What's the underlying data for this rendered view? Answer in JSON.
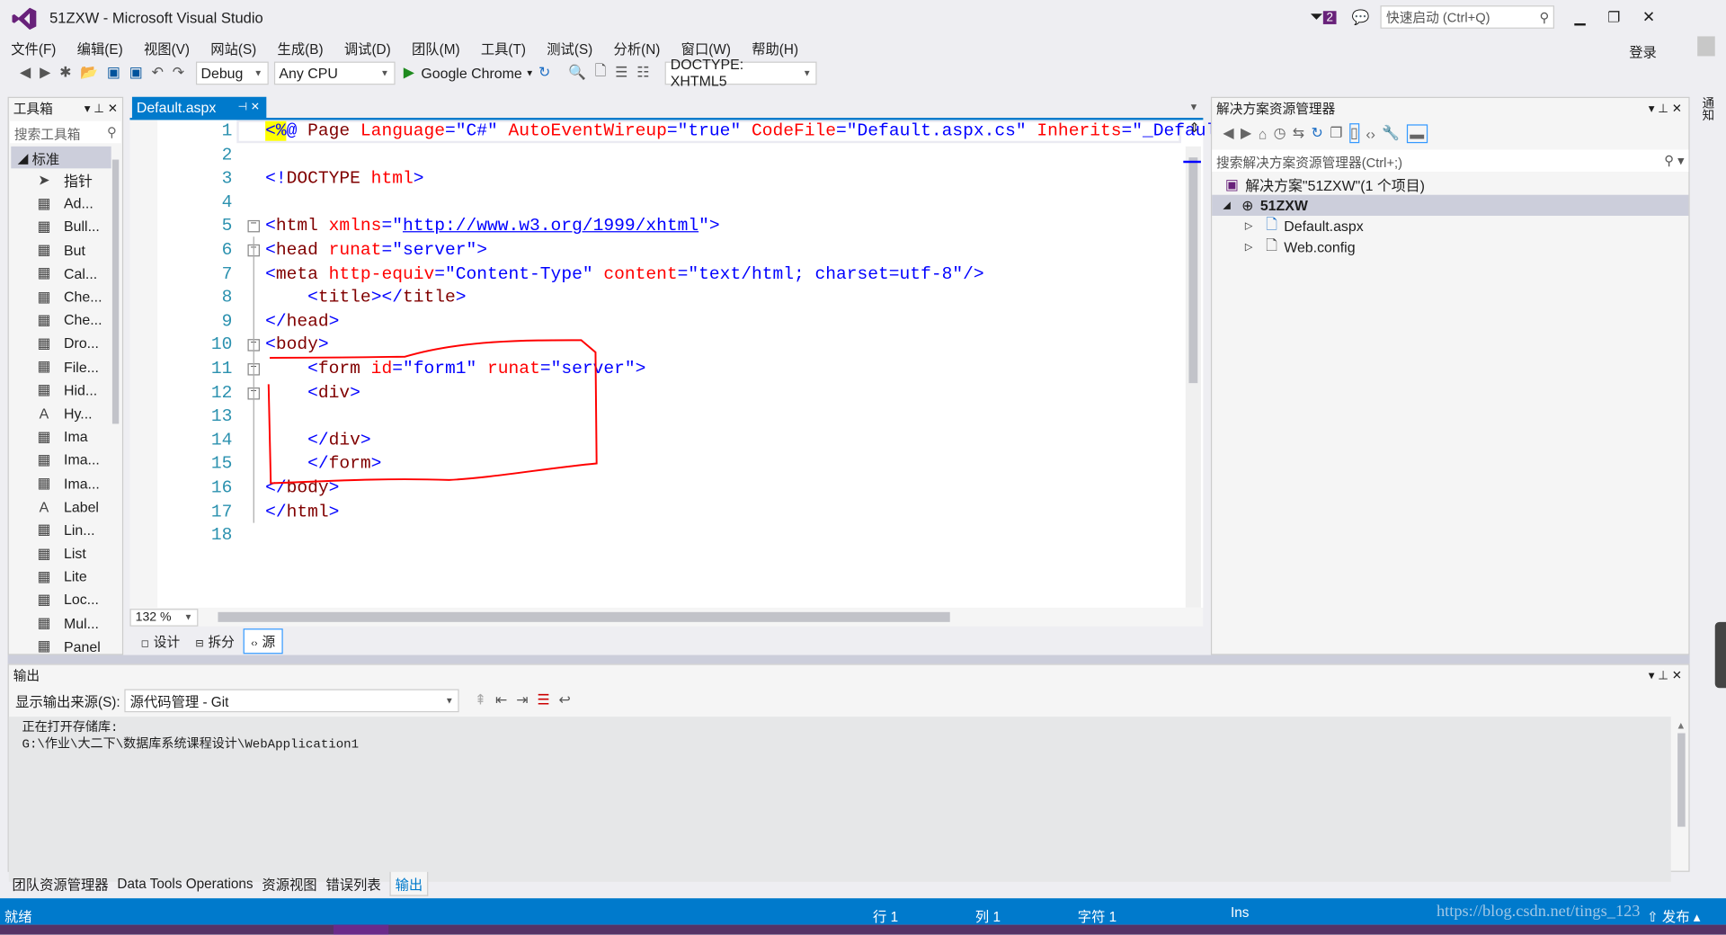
{
  "window": {
    "title": "51ZXW - Microsoft Visual Studio",
    "notification_count": "2",
    "quick_launch_placeholder": "快速启动 (Ctrl+Q)",
    "login": "登录",
    "notifications_tab": "通知"
  },
  "menu": [
    "文件(F)",
    "编辑(E)",
    "视图(V)",
    "网站(S)",
    "生成(B)",
    "调试(D)",
    "团队(M)",
    "工具(T)",
    "测试(S)",
    "分析(N)",
    "窗口(W)",
    "帮助(H)"
  ],
  "toolbar": {
    "config": "Debug",
    "platform": "Any CPU",
    "run_target": "Google Chrome",
    "doctype": "DOCTYPE: XHTML5"
  },
  "toolbox": {
    "title": "工具箱",
    "search_placeholder": "搜索工具箱",
    "group": "标准",
    "items": [
      {
        "icon": "pointer-icon",
        "label": "指针"
      },
      {
        "icon": "adrotator-icon",
        "label": "Ad..."
      },
      {
        "icon": "bulleted-list-icon",
        "label": "Bull..."
      },
      {
        "icon": "button-icon",
        "label": "But"
      },
      {
        "icon": "calendar-icon",
        "label": "Cal..."
      },
      {
        "icon": "checkbox-icon",
        "label": "Che..."
      },
      {
        "icon": "checkbox-list-icon",
        "label": "Che..."
      },
      {
        "icon": "dropdown-icon",
        "label": "Dro..."
      },
      {
        "icon": "fileupload-icon",
        "label": "File..."
      },
      {
        "icon": "hiddenfield-icon",
        "label": "Hid..."
      },
      {
        "icon": "hyperlink-icon",
        "label": "Hy..."
      },
      {
        "icon": "image-icon",
        "label": "Ima"
      },
      {
        "icon": "imagebutton-icon",
        "label": "Ima..."
      },
      {
        "icon": "imagemap-icon",
        "label": "Ima..."
      },
      {
        "icon": "label-icon",
        "label": "Label"
      },
      {
        "icon": "linkbutton-icon",
        "label": "Lin..."
      },
      {
        "icon": "list-icon",
        "label": "List"
      },
      {
        "icon": "literal-icon",
        "label": "Lite"
      },
      {
        "icon": "localize-icon",
        "label": "Loc..."
      },
      {
        "icon": "multiview-icon",
        "label": "Mul..."
      },
      {
        "icon": "panel-icon",
        "label": "Panel"
      }
    ]
  },
  "editor": {
    "tab": "Default.aspx",
    "zoom": "132 %",
    "views": [
      "设计",
      "拆分",
      "源"
    ],
    "active_view": "源",
    "lines": [
      [
        [
          "<%",
          "b dir"
        ],
        [
          "@",
          "v"
        ],
        [
          " Page ",
          "tg"
        ],
        [
          "Language",
          "at"
        ],
        [
          "=",
          "b"
        ],
        [
          "\"C#\"",
          "v"
        ],
        [
          " AutoEventWireup",
          "at"
        ],
        [
          "=",
          "b"
        ],
        [
          "\"true\"",
          "v"
        ],
        [
          " CodeFile",
          "at"
        ],
        [
          "=",
          "b"
        ],
        [
          "\"Default.aspx.cs\"",
          "v"
        ],
        [
          " Inherits",
          "at"
        ],
        [
          "=",
          "b"
        ],
        [
          "\"_Default\"",
          "v"
        ],
        [
          " ",
          ""
        ],
        [
          "%>",
          "b dir"
        ]
      ],
      [],
      [
        [
          "<!",
          "b"
        ],
        [
          "DOCTYPE",
          "tg"
        ],
        [
          " html",
          "at"
        ],
        [
          ">",
          "b"
        ]
      ],
      [],
      [
        [
          "<",
          "b"
        ],
        [
          "html",
          "tg"
        ],
        [
          " xmlns",
          "at"
        ],
        [
          "=\"",
          "b"
        ],
        [
          "http://www.w3.org/1999/xhtml",
          "url"
        ],
        [
          "\">",
          "b"
        ]
      ],
      [
        [
          "<",
          "b"
        ],
        [
          "head",
          "tg"
        ],
        [
          " runat",
          "at"
        ],
        [
          "=\"",
          "b"
        ],
        [
          "server",
          "v"
        ],
        [
          "\">",
          "b"
        ]
      ],
      [
        [
          "<",
          "b"
        ],
        [
          "meta",
          "tg"
        ],
        [
          " http-equiv",
          "at"
        ],
        [
          "=\"",
          "b"
        ],
        [
          "Content-Type",
          "v"
        ],
        [
          "\"",
          "b"
        ],
        [
          " content",
          "at"
        ],
        [
          "=\"",
          "b"
        ],
        [
          "text/html; charset=utf-8",
          "v"
        ],
        [
          "\"/>",
          "b"
        ]
      ],
      [
        [
          "    <",
          "b"
        ],
        [
          "title",
          "tg"
        ],
        [
          "></",
          "b"
        ],
        [
          "title",
          "tg"
        ],
        [
          ">",
          "b"
        ]
      ],
      [
        [
          "</",
          "b"
        ],
        [
          "head",
          "tg"
        ],
        [
          ">",
          "b"
        ]
      ],
      [
        [
          "<",
          "b"
        ],
        [
          "body",
          "tg"
        ],
        [
          ">",
          "b"
        ]
      ],
      [
        [
          "    <",
          "b"
        ],
        [
          "form",
          "tg"
        ],
        [
          " id",
          "at"
        ],
        [
          "=\"",
          "b"
        ],
        [
          "form1",
          "v"
        ],
        [
          "\"",
          "b"
        ],
        [
          " runat",
          "at"
        ],
        [
          "=\"",
          "b"
        ],
        [
          "server",
          "v"
        ],
        [
          "\">",
          "b"
        ]
      ],
      [
        [
          "    <",
          "b"
        ],
        [
          "div",
          "tg"
        ],
        [
          ">",
          "b"
        ]
      ],
      [],
      [
        [
          "    </",
          "b"
        ],
        [
          "div",
          "tg"
        ],
        [
          ">",
          "b"
        ]
      ],
      [
        [
          "    </",
          "b"
        ],
        [
          "form",
          "tg"
        ],
        [
          ">",
          "b"
        ]
      ],
      [
        [
          "</",
          "b"
        ],
        [
          "body",
          "tg"
        ],
        [
          ">",
          "b"
        ]
      ],
      [
        [
          "</",
          "b"
        ],
        [
          "html",
          "tg"
        ],
        [
          ">",
          "b"
        ]
      ],
      []
    ]
  },
  "solution_explorer": {
    "title": "解决方案资源管理器",
    "search_placeholder": "搜索解决方案资源管理器(Ctrl+;)",
    "solution": "解决方案\"51ZXW\"(1 个项目)",
    "project": "51ZXW",
    "files": [
      "Default.aspx",
      "Web.config"
    ]
  },
  "output": {
    "title": "输出",
    "source_label": "显示输出来源(S):",
    "source": "源代码管理 - Git",
    "lines": [
      "正在打开存储库:",
      "G:\\作业\\大二下\\数据库系统课程设计\\WebApplication1"
    ]
  },
  "bottom_tabs": [
    "团队资源管理器",
    "Data Tools Operations",
    "资源视图",
    "错误列表",
    "输出"
  ],
  "active_bottom_tab": "输出",
  "status": {
    "ready": "就绪",
    "line": "行 1",
    "col": "列 1",
    "char": "字符 1",
    "mode": "Ins",
    "publish": "发布",
    "watermark": "https://blog.csdn.net/tings_123"
  },
  "colors": {
    "accent": "#007acc",
    "annotation": "#ff0000"
  }
}
